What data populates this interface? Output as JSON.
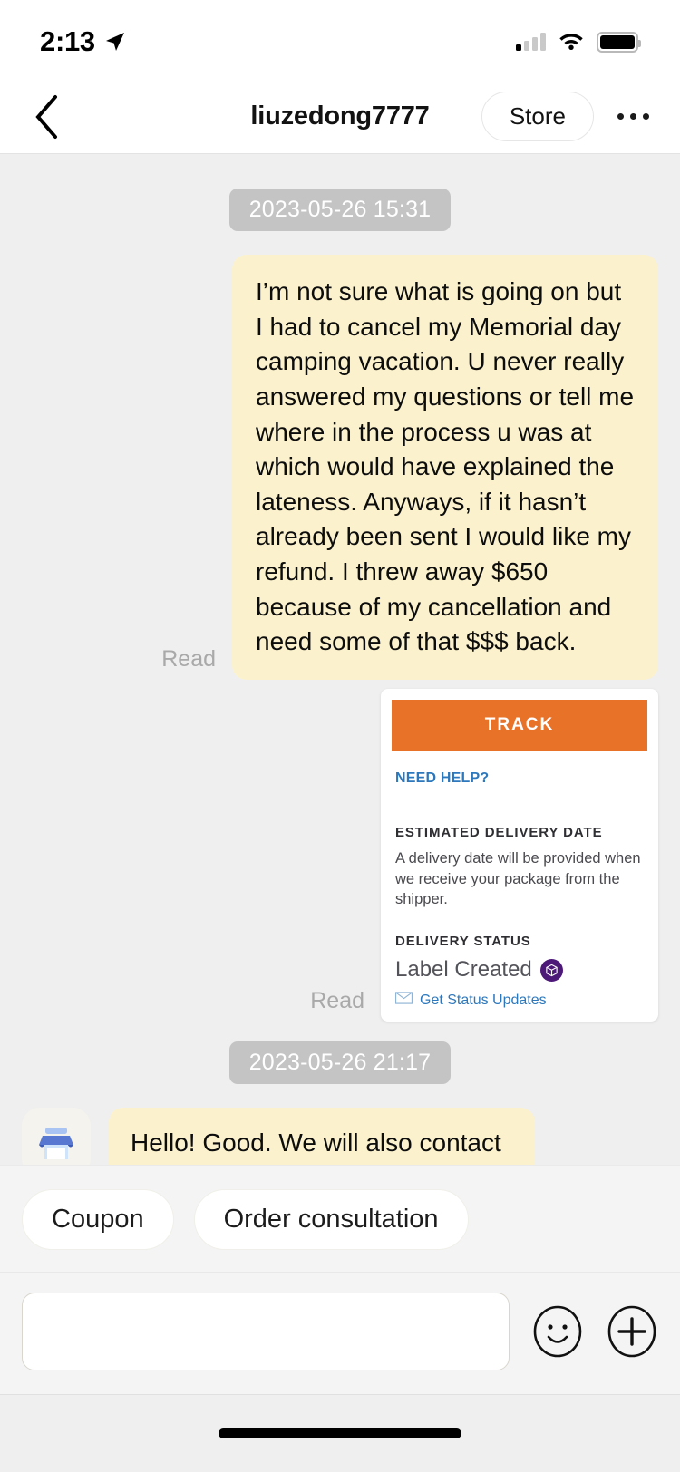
{
  "status_bar": {
    "time": "2:13",
    "location_icon": "location-arrow-icon",
    "signal_icon": "cellular-signal-icon",
    "wifi_icon": "wifi-icon",
    "battery_icon": "battery-full-icon"
  },
  "nav": {
    "back_icon": "chevron-left-icon",
    "title": "liuzedong7777",
    "store_label": "Store",
    "more_icon": "more-options-icon"
  },
  "chat": {
    "timestamp_1": "2023-05-26 15:31",
    "timestamp_2": "2023-05-26 21:17",
    "read_label_1": "Read",
    "read_label_2": "Read",
    "message_1": "I’m not sure what is going on but I had to cancel my Memorial day camping vacation. U never really answered my questions or tell me where in the process u was at which would have explained the lateness. Anyways, if it hasn’t already been sent I would like my refund. I threw away $650 because of my cancellation and need some of that $$$ back.",
    "message_2": "Hello! Good. We will also contact the feds. It will be updated as soon as possible. Thanks!",
    "avatar_icon": "storefront-icon"
  },
  "tracking_card": {
    "track_button": "TRACK",
    "need_help": "NEED HELP?",
    "estimated_label": "ESTIMATED DELIVERY DATE",
    "estimated_text": "A delivery date will be provided when we receive your package from the shipper.",
    "status_label": "DELIVERY STATUS",
    "status_value": "Label Created",
    "status_badge_icon": "package-box-icon",
    "updates_icon": "envelope-icon",
    "updates_link": "Get Status Updates"
  },
  "quick_replies": [
    {
      "label": "Coupon"
    },
    {
      "label": "Order consultation"
    }
  ],
  "composer": {
    "input_value": "",
    "input_placeholder": "",
    "emoji_icon": "smiley-face-icon",
    "add_icon": "plus-circle-icon"
  },
  "colors": {
    "bubble_yellow": "#fbf2cd",
    "track_orange": "#e97229",
    "link_blue": "#2d78bd",
    "badge_purple": "#4d1979",
    "chat_bg": "#efefef",
    "timestamp_grey": "#c4c4c4"
  }
}
